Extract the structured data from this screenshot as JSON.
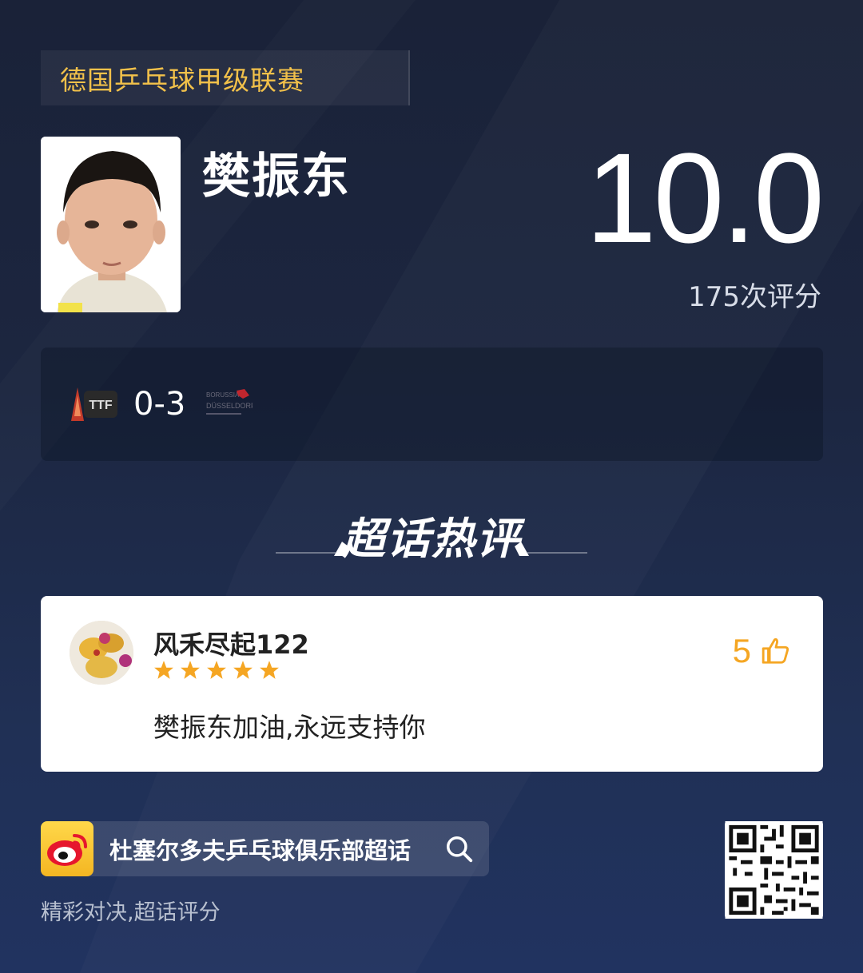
{
  "league": {
    "name": "德国乒乓球甲级联赛"
  },
  "player": {
    "name": "樊振东",
    "score": "10.0",
    "rating_count": "175次评分"
  },
  "match": {
    "team_a": "",
    "score": "0-3",
    "team_b": "BORUSSIA DÜSSELDORF"
  },
  "section": {
    "title": "超话热评"
  },
  "comment": {
    "user": "风禾尽起122",
    "stars": 5,
    "likes": "5",
    "text": "樊振东加油,永远支持你"
  },
  "footer": {
    "topic": "杜塞尔多夫乒乓球俱乐部超话",
    "tagline": "精彩对决,超话评分"
  },
  "colors": {
    "accent_gold": "#f2c14a",
    "star": "#f5a623",
    "bg_dark": "#1a2238"
  }
}
